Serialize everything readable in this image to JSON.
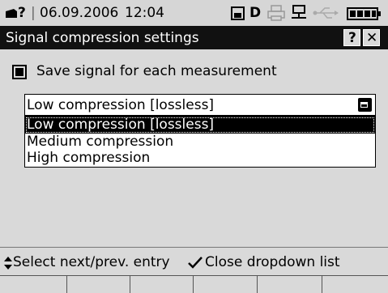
{
  "status": {
    "prefix": "?",
    "date": "06.09.2006",
    "time": "12:04",
    "drive_letter": "D"
  },
  "title": "Signal compression settings",
  "title_buttons": {
    "help": "?",
    "close": "✕"
  },
  "checkbox": {
    "label": "Save signal for each measurement",
    "checked": true
  },
  "dropdown": {
    "value": "Low compression [lossless]",
    "options": [
      {
        "label": "Low compression [lossless]",
        "selected": true
      },
      {
        "label": "Medium compression",
        "selected": false
      },
      {
        "label": "High compression",
        "selected": false
      }
    ]
  },
  "hints": {
    "select": "Select next/prev. entry",
    "close": "Close dropdown list"
  }
}
